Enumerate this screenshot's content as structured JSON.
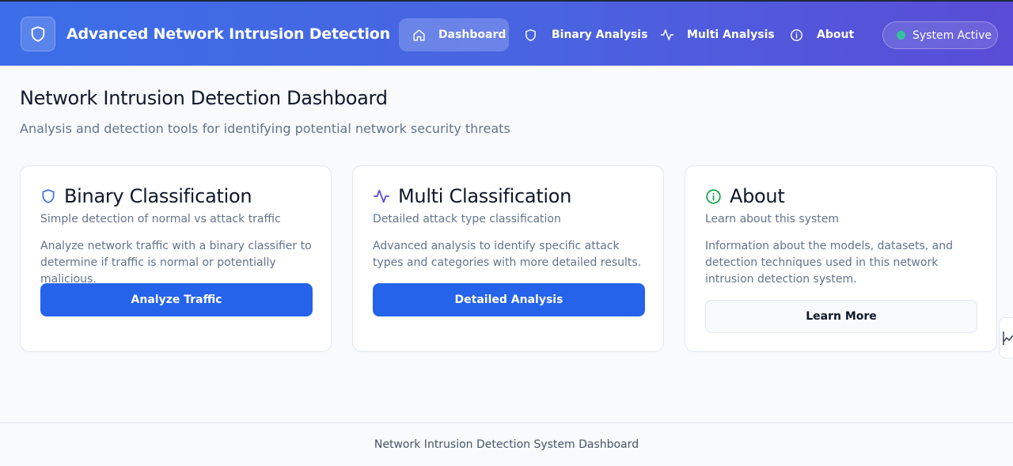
{
  "app": {
    "title": "Advanced Network Intrusion Detection",
    "logo_icon": "shield-icon"
  },
  "nav": {
    "items": [
      {
        "label": "Dashboard",
        "icon": "home-icon",
        "active": true
      },
      {
        "label": "Binary Analysis",
        "icon": "shield-icon",
        "active": false
      },
      {
        "label": "Multi Analysis",
        "icon": "activity-icon",
        "active": false
      },
      {
        "label": "About",
        "icon": "info-icon",
        "active": false
      }
    ],
    "status": {
      "label": "System Active",
      "color": "#34c29a"
    }
  },
  "main": {
    "title": "Network Intrusion Detection Dashboard",
    "subtitle": "Analysis and detection tools for identifying potential network security threats"
  },
  "cards": [
    {
      "icon": "shield-icon",
      "icon_color": "#3b6ee8",
      "title": "Binary Classification",
      "description": "Simple detection of normal vs attack traffic",
      "body": "Analyze network traffic with a binary classifier to determine if traffic is normal or potentially malicious.",
      "button": "Analyze Traffic"
    },
    {
      "icon": "activity-icon",
      "icon_color": "#5b4fd6",
      "title": "Multi Classification",
      "description": "Detailed attack type classification",
      "body": "Advanced analysis to identify specific attack types and categories with more detailed results.",
      "button": "Detailed Analysis"
    },
    {
      "icon": "info-icon",
      "icon_color": "#16a34a",
      "title": "About",
      "description": "Learn about this system",
      "body": "Information about the models, datasets, and detection techniques used in this network intrusion detection system.",
      "button": "Learn More"
    }
  ],
  "footer": {
    "text": "Network Intrusion Detection System Dashboard"
  },
  "colors": {
    "primary": "#2563eb",
    "header_start": "#3b6ee8",
    "header_end": "#5a4cd6"
  }
}
